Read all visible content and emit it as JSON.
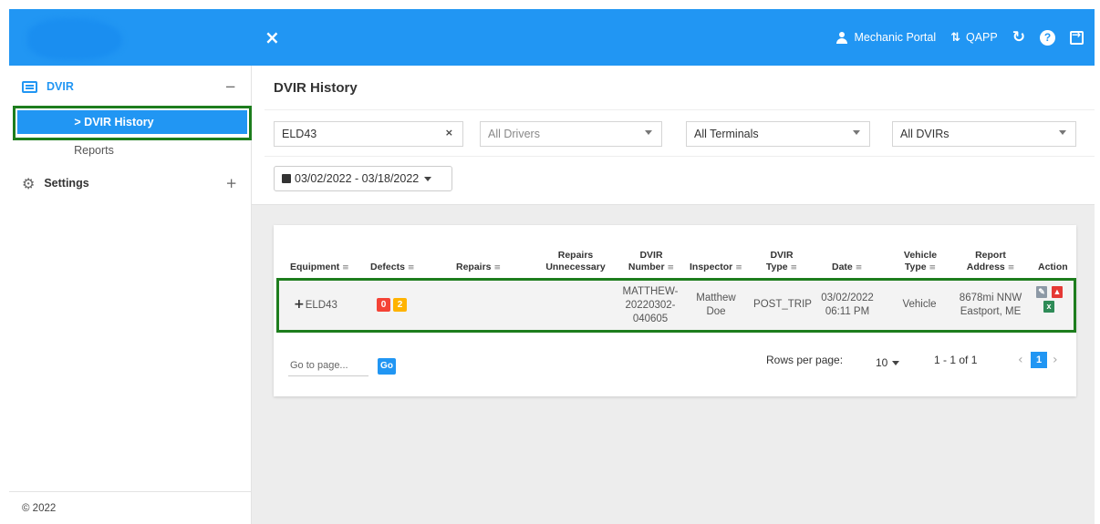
{
  "topbar": {
    "close_icon": "×",
    "mechanic_portal": "Mechanic Portal",
    "qapp": "QAPP",
    "refresh_icon": "C",
    "help_icon": "?"
  },
  "sidebar": {
    "dvir_label": "DVIR",
    "dvir_toggle": "−",
    "dvir_history": "> DVIR History",
    "reports": "Reports",
    "settings_label": "Settings",
    "settings_toggle": "+",
    "copyright": "© 2022"
  },
  "main": {
    "title": "DVIR History",
    "filters": {
      "equipment_value": "ELD43",
      "clear_icon": "×",
      "drivers_placeholder": "All Drivers",
      "terminals_value": "All Terminals",
      "dvirs_value": "All DVIRs"
    },
    "date_range": "03/02/2022 - 03/18/2022"
  },
  "table": {
    "sort_icon": "≡",
    "headers": {
      "equipment": "Equipment",
      "defects": "Defects",
      "repairs": "Repairs",
      "repairs_unnecessary_1": "Repairs",
      "repairs_unnecessary_2": "Unnecessary",
      "dvir_number_1": "DVIR",
      "dvir_number_2": "Number",
      "inspector": "Inspector",
      "dvir_type_1": "DVIR",
      "dvir_type_2": "Type",
      "date": "Date",
      "vehicle_type_1": "Vehicle",
      "vehicle_type_2": "Type",
      "report_address_1": "Report",
      "report_address_2": "Address",
      "action": "Action"
    },
    "rows": [
      {
        "expand": "+",
        "equipment": "ELD43",
        "defects_red": "0",
        "defects_orange": "2",
        "dvir_number_1": "MATTHEW-",
        "dvir_number_2": "20220302-",
        "dvir_number_3": "040605",
        "inspector_1": "Matthew",
        "inspector_2": "Doe",
        "dvir_type": "POST_TRIP",
        "date_1": "03/02/2022",
        "date_2": "06:11 PM",
        "vehicle_type": "Vehicle",
        "address_1": "8678mi NNW",
        "address_2": "Eastport, ME"
      }
    ]
  },
  "pagination": {
    "goto_placeholder": "Go to page...",
    "go_label": "Go",
    "rows_per_page_label": "Rows per page:",
    "rows_per_page_value": "10",
    "range": "1 - 1 of 1",
    "prev": "‹",
    "current_page": "1",
    "next": "›"
  },
  "colors": {
    "primary": "#2196f3",
    "highlight_border": "#1d7d1d",
    "badge_red": "#f44336",
    "badge_orange": "#ffb300"
  }
}
